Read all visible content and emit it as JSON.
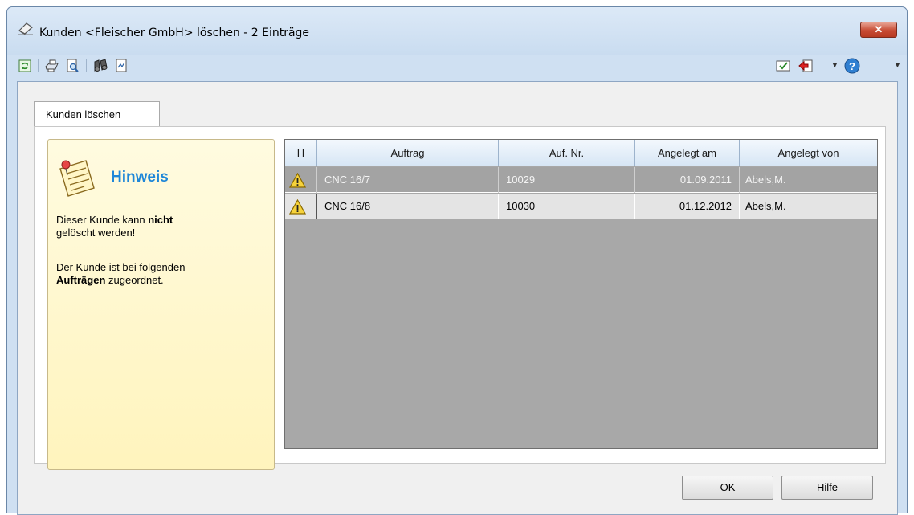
{
  "window": {
    "title": "Kunden <Fleischer GmbH> löschen - 2 Einträge",
    "close_label": "✕"
  },
  "toolbar": {
    "left_icons": [
      "refresh-icon",
      "print-icon",
      "print-preview-icon",
      "binoculars-icon",
      "export-icon"
    ],
    "right_icons": [
      "checklist-icon",
      "exit-icon",
      "help-icon"
    ]
  },
  "tab": {
    "label": "Kunden löschen"
  },
  "hint": {
    "title": "Hinweis",
    "line1_pre": "Dieser Kunde kann ",
    "line1_bold": "nicht",
    "line2": "gelöscht werden!",
    "line3": "Der Kunde ist bei folgenden",
    "line4_bold": "Aufträgen",
    "line4_post": " zugeordnet."
  },
  "table": {
    "columns": [
      "H",
      "Auftrag",
      "Auf. Nr.",
      "Angelegt am",
      "Angelegt von"
    ],
    "rows": [
      {
        "auftrag": "CNC 16/7",
        "nr": "10029",
        "datum": "01.09.2011",
        "von": "Abels,M."
      },
      {
        "auftrag": "CNC 16/8",
        "nr": "10030",
        "datum": "01.12.2012",
        "von": "Abels,M."
      }
    ]
  },
  "buttons": {
    "ok": "OK",
    "help": "Hilfe"
  },
  "colors": {
    "accent": "#1f87d8",
    "window_frame": "#cfe0f2",
    "selected_row": "#a3a3a3",
    "grid_bg": "#a8a8a8"
  }
}
